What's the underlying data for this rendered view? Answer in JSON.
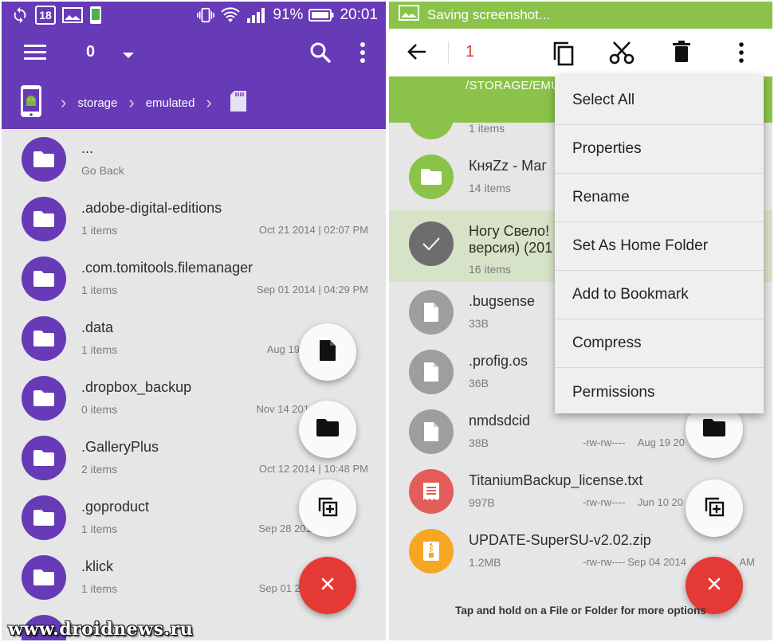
{
  "left": {
    "status": {
      "calendar_day": "18",
      "battery": "91%",
      "time": "20:01"
    },
    "toolbar": {
      "count": "0"
    },
    "breadcrumb": [
      "storage",
      "emulated"
    ],
    "items": [
      {
        "name": "...",
        "sub": "Go Back",
        "date": ""
      },
      {
        "name": ".adobe-digital-editions",
        "sub": "1 items",
        "date": "Oct 21 2014 | 02:07 PM"
      },
      {
        "name": ".com.tomitools.filemanager",
        "sub": "1 items",
        "date": "Sep 01 2014 | 04:29 PM"
      },
      {
        "name": ".data",
        "sub": "1 items",
        "date": "Aug 19 20"
      },
      {
        "name": ".dropbox_backup",
        "sub": "0 items",
        "date": "Nov 14 201"
      },
      {
        "name": ".GalleryPlus",
        "sub": "2 items",
        "date": "Oct 12 2014 | 10:48 PM"
      },
      {
        "name": ".goproduct",
        "sub": "1 items",
        "date": "Sep 28 2014"
      },
      {
        "name": ".klick",
        "sub": "1 items",
        "date": "Sep 01 20"
      }
    ]
  },
  "right": {
    "status": {
      "saving": "Saving screenshot..."
    },
    "toolbar": {
      "count": "1"
    },
    "path": "/STORAGE/EMU",
    "items": [
      {
        "name": "",
        "sub": "1 items",
        "perm": "",
        "date": "",
        "color": "#8bc34a"
      },
      {
        "name": "КняZz - Маг",
        "sub": "14 items",
        "perm": "",
        "date": "",
        "color": "#8bc34a"
      },
      {
        "name": "Ногу Свело!",
        "name2": "версия) (201",
        "sub": "16 items",
        "perm": "",
        "date": "",
        "color": "#6d6d6d"
      },
      {
        "name": ".bugsense",
        "sub": "33B",
        "perm": "",
        "date": "",
        "color": "#9e9e9e"
      },
      {
        "name": ".profig.os",
        "sub": "36B",
        "perm": "",
        "date": "",
        "color": "#9e9e9e"
      },
      {
        "name": "nmdsdcid",
        "sub": "38B",
        "perm": "-rw-rw----",
        "date": "Aug 19 20",
        "color": "#9e9e9e"
      },
      {
        "name": "TitaniumBackup_license.txt",
        "sub": "997B",
        "perm": "-rw-rw----",
        "date": "Jun 10 20",
        "color": "#e35d5b"
      },
      {
        "name": "UPDATE-SuperSU-v2.02.zip",
        "sub": "1.2MB",
        "perm": "-rw-rw----",
        "date": "Sep 04 2014",
        "date_tail": "AM",
        "color": "#f6a623"
      }
    ],
    "menu": [
      "Select All",
      "Properties",
      "Rename",
      "Set As Home Folder",
      "Add to Bookmark",
      "Compress",
      "Permissions"
    ],
    "hint": "Tap and hold on a File or Folder for more options"
  },
  "watermark": "www.droidnews.ru",
  "colors": {
    "purple": "#673ab7",
    "green": "#8bc34a",
    "red_fab": "#e53935",
    "counter_red": "#e53935"
  }
}
